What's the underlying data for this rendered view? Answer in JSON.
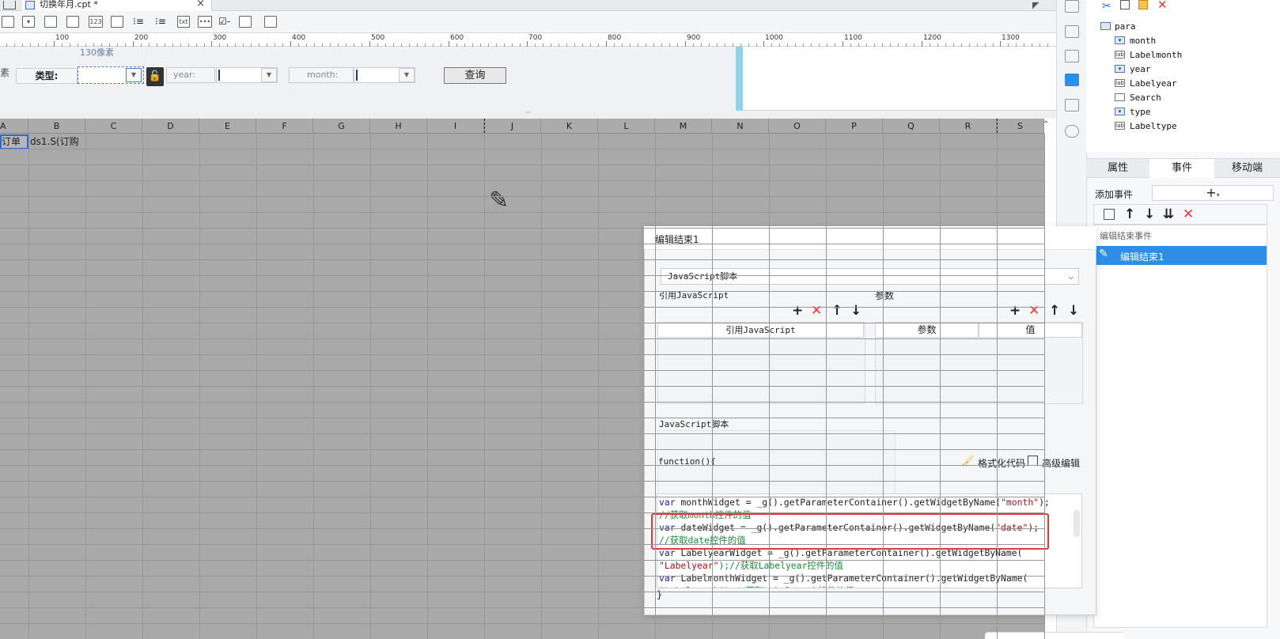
{
  "tabs": {
    "file_name": "切换年月.cpt *",
    "close": "×"
  },
  "ruler": {
    "labels": [
      "100",
      "200",
      "300",
      "400",
      "500",
      "600",
      "700",
      "800",
      "900",
      "1000",
      "1100",
      "1200",
      "1300"
    ]
  },
  "param_pane": {
    "edge_char": "素",
    "size_hint": "130像素",
    "type_label": "类型:",
    "year_label": "year:",
    "month_label": "month:",
    "query_button": "查询"
  },
  "sheet": {
    "columns": [
      "A",
      "B",
      "C",
      "D",
      "E",
      "F",
      "G",
      "H",
      "I",
      "J",
      "K",
      "L",
      "M",
      "N",
      "O",
      "P",
      "Q",
      "R",
      "S"
    ],
    "cell_a1": "订单",
    "cell_b1": "ds1.S(订购"
  },
  "tree": {
    "root": "para",
    "items": [
      {
        "name": "month",
        "kind": "combo"
      },
      {
        "name": "Labelmonth",
        "kind": "label"
      },
      {
        "name": "year",
        "kind": "combo"
      },
      {
        "name": "Labelyear",
        "kind": "label"
      },
      {
        "name": "Search",
        "kind": "search"
      },
      {
        "name": "type",
        "kind": "combo"
      },
      {
        "name": "Labeltype",
        "kind": "label"
      }
    ]
  },
  "right_tabs": [
    "属性",
    "事件",
    "移动端"
  ],
  "events": {
    "add_label": "添加事件",
    "group_label": "编辑结束事件",
    "selected_item": "编辑结束1"
  },
  "dialog": {
    "title": "编辑结束1",
    "script_type": "JavaScript脚本",
    "ref_js_label": "引用JavaScript",
    "params_label": "参数",
    "ref_js_col": "引用JavaScript",
    "param_col": "参数",
    "value_col": "值",
    "js_script_label": "JavaScript脚本",
    "function_header": "function(){",
    "format_code": "格式化代码",
    "advanced_edit": "高级编辑",
    "closing_brace": "}"
  },
  "code_lines": [
    {
      "kw": "var ",
      "text": "monthWidget = _g().getParameterContainer().getWidgetByName(",
      "str": "\"month\"",
      "tail": ");"
    },
    {
      "comment": "//获取month控件的值"
    },
    {
      "kw": "var ",
      "text": "dateWidget = _g().getParameterContainer().getWidgetByName(",
      "str": "\"date\"",
      "tail": ");"
    },
    {
      "comment": "//获取date控件的值"
    },
    {
      "kw": "var ",
      "text": "LabelyearWidget = _g().getParameterContainer().getWidgetByName(",
      "str": "",
      "tail": ""
    },
    {
      "kw": "",
      "text": "",
      "str": "\"Labelyear\"",
      "tail": ");//获取Labelyear控件的值"
    },
    {
      "kw": "var ",
      "text": "LabelmonthWidget = _g().getParameterContainer().getWidgetByName(",
      "str": "",
      "tail": ""
    },
    {
      "kw": "",
      "text": "",
      "str": "\"Labelmonth\"",
      "tail": ");//获取Labelmonth控件的值"
    }
  ]
}
